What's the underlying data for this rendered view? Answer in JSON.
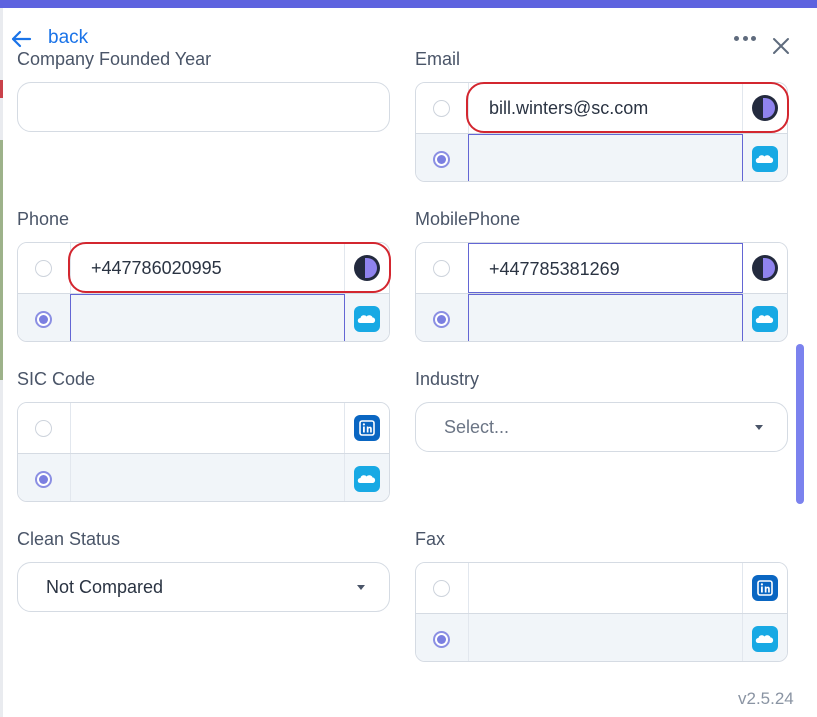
{
  "header": {
    "back_label": "back"
  },
  "fields": {
    "company_founded_year": {
      "label": "Company Founded Year",
      "value": ""
    },
    "email": {
      "label": "Email",
      "options": [
        {
          "value": "bill.winters@sc.com",
          "source": "dark-source-icon",
          "selected": false
        },
        {
          "value": "",
          "source": "salesforce-icon",
          "selected": true
        }
      ]
    },
    "phone": {
      "label": "Phone",
      "options": [
        {
          "value": "+447786020995",
          "source": "dark-source-icon",
          "selected": false
        },
        {
          "value": "",
          "source": "salesforce-icon",
          "selected": true
        }
      ]
    },
    "mobile_phone": {
      "label": "MobilePhone",
      "options": [
        {
          "value": "+447785381269",
          "source": "dark-source-icon",
          "selected": false
        },
        {
          "value": "",
          "source": "salesforce-icon",
          "selected": true
        }
      ]
    },
    "sic_code": {
      "label": "SIC Code",
      "options": [
        {
          "value": "",
          "source": "linkedin-icon",
          "selected": false
        },
        {
          "value": "",
          "source": "salesforce-icon",
          "selected": true
        }
      ]
    },
    "industry": {
      "label": "Industry",
      "placeholder": "Select..."
    },
    "clean_status": {
      "label": "Clean Status",
      "value": "Not Compared"
    },
    "fax": {
      "label": "Fax",
      "options": [
        {
          "value": "",
          "source": "linkedin-icon",
          "selected": false
        },
        {
          "value": "",
          "source": "salesforce-icon",
          "selected": true
        }
      ]
    }
  },
  "footer": {
    "version": "v2.5.24"
  },
  "colors": {
    "accent": "#5e63df",
    "link": "#1a73e8",
    "highlight": "#d3262f",
    "salesforce": "#18a9e4",
    "linkedin": "#0a66c2"
  }
}
